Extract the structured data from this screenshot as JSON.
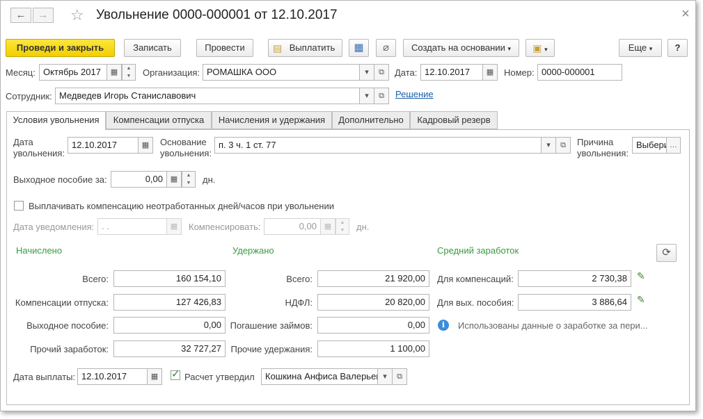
{
  "window": {
    "title": "Увольнение 0000-000001 от 12.10.2017"
  },
  "icons": {
    "back": "←",
    "forward": "→",
    "star": "☆",
    "close": "×",
    "calendar": "calendar-icon",
    "dropdown": "▾",
    "open": "⧉"
  },
  "toolbar": {
    "post_close": "Проведи и закрыть",
    "save": "Записать",
    "post": "Провести",
    "pay": "Выплатить",
    "create_based": "Создать на основании",
    "more": "Еще",
    "help": "?"
  },
  "header": {
    "month_label": "Месяц:",
    "month_value": "Октябрь 2017",
    "org_label": "Организация:",
    "org_value": "РОМАШКА ООО",
    "date_label": "Дата:",
    "date_value": "12.10.2017",
    "number_label": "Номер:",
    "number_value": "0000-000001",
    "employee_label": "Сотрудник:",
    "employee_value": "Медведев Игорь Станиславович",
    "decision_link": "Решение"
  },
  "tabs": [
    "Условия увольнения",
    "Компенсации отпуска",
    "Начисления и удержания",
    "Дополнительно",
    "Кадровый резерв"
  ],
  "conditions": {
    "dismissal_date_label1": "Дата",
    "dismissal_date_label2": "увольнения:",
    "dismissal_date_value": "12.10.2017",
    "basis_label1": "Основание",
    "basis_label2": "увольнения:",
    "basis_value": "п. 3 ч. 1 ст. 77",
    "reason_label1": "Причина",
    "reason_label2": "увольнения:",
    "reason_value": "Выбери",
    "severance_label": "Выходное пособие за:",
    "severance_value": "0,00",
    "severance_unit": "дн.",
    "compensation_checkbox": "Выплачивать компенсацию неотработанных дней/часов при увольнении",
    "notice_date_label": "Дата уведомления:",
    "notice_date_value": " .  .",
    "compensate_label": "Компенсировать:",
    "compensate_value": "0,00",
    "compensate_unit": "дн."
  },
  "accrued": {
    "heading": "Начислено",
    "total_label": "Всего:",
    "total_value": "160 154,10",
    "vacation_label": "Компенсации отпуска:",
    "vacation_value": "127 426,83",
    "severance_label": "Выходное пособие:",
    "severance_value": "0,00",
    "other_label": "Прочий заработок:",
    "other_value": "32 727,27"
  },
  "withheld": {
    "heading": "Удержано",
    "total_label": "Всего:",
    "total_value": "21 920,00",
    "ndfl_label": "НДФЛ:",
    "ndfl_value": "20 820,00",
    "loans_label": "Погашение займов:",
    "loans_value": "0,00",
    "other_label": "Прочие удержания:",
    "other_value": "1 100,00"
  },
  "average": {
    "heading": "Средний заработок",
    "comp_label": "Для компенсаций:",
    "comp_value": "2 730,38",
    "sev_label": "Для вых. пособия:",
    "sev_value": "3 886,64",
    "info_text": "Использованы данные о заработке за пери..."
  },
  "footer": {
    "pay_date_label": "Дата выплаты:",
    "pay_date_value": "12.10.2017",
    "approved_label": "Расчет утвердил",
    "approved_value": "Кошкина Анфиса Валерьев"
  }
}
